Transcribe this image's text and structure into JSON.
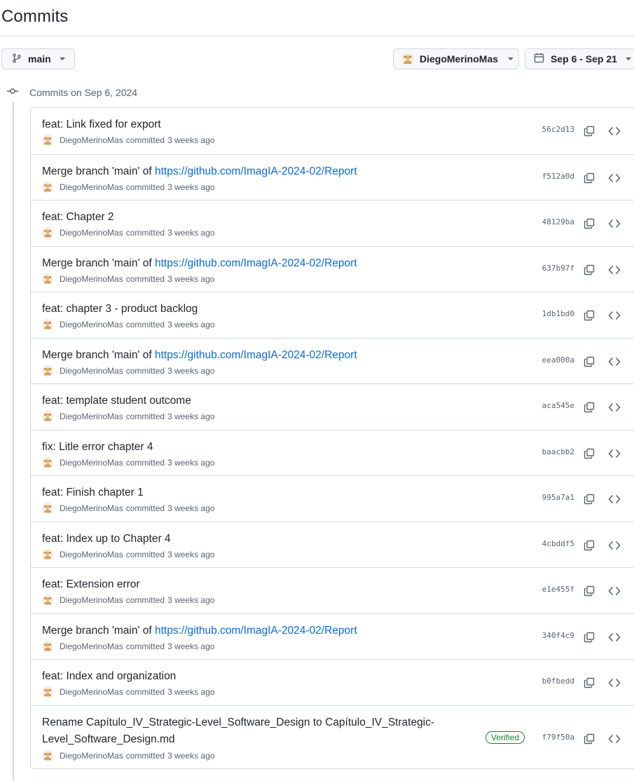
{
  "page": {
    "title": "Commits"
  },
  "toolbar": {
    "branch_label": "main",
    "user_label": "DiegoMerinoMas",
    "date_range_label": "Sep 6 - Sep 21"
  },
  "group": {
    "label": "Commits on Sep 6, 2024"
  },
  "commits": [
    {
      "title": "feat: Link fixed for export",
      "author": "DiegoMerinoMas",
      "action": "committed",
      "time": "3 weeks ago",
      "sha": "56c2d13"
    },
    {
      "title_prefix": "Merge branch 'main' of ",
      "link": "https://github.com/ImagIA-2024-02/Report",
      "author": "DiegoMerinoMas",
      "action": "committed",
      "time": "3 weeks ago",
      "sha": "f512a0d"
    },
    {
      "title": "feat: Chapter 2",
      "author": "DiegoMerinoMas",
      "action": "committed",
      "time": "3 weeks ago",
      "sha": "48129ba"
    },
    {
      "title_prefix": "Merge branch 'main' of ",
      "link": "https://github.com/ImagIA-2024-02/Report",
      "author": "DiegoMerinoMas",
      "action": "committed",
      "time": "3 weeks ago",
      "sha": "637b97f"
    },
    {
      "title": "feat: chapter 3 - product backlog",
      "author": "DiegoMerinoMas",
      "action": "committed",
      "time": "3 weeks ago",
      "sha": "1db1bd0"
    },
    {
      "title_prefix": "Merge branch 'main' of ",
      "link": "https://github.com/ImagIA-2024-02/Report",
      "author": "DiegoMerinoMas",
      "action": "committed",
      "time": "3 weeks ago",
      "sha": "eea000a"
    },
    {
      "title": "feat: template student outcome",
      "author": "DiegoMerinoMas",
      "action": "committed",
      "time": "3 weeks ago",
      "sha": "aca545e"
    },
    {
      "title": "fix: Litle error chapter 4",
      "author": "DiegoMerinoMas",
      "action": "committed",
      "time": "3 weeks ago",
      "sha": "baacbb2"
    },
    {
      "title": "feat: Finish chapter 1",
      "author": "DiegoMerinoMas",
      "action": "committed",
      "time": "3 weeks ago",
      "sha": "995a7a1"
    },
    {
      "title": "feat: Index up to Chapter 4",
      "author": "DiegoMerinoMas",
      "action": "committed",
      "time": "3 weeks ago",
      "sha": "4cbddf5"
    },
    {
      "title": "feat: Extension error",
      "author": "DiegoMerinoMas",
      "action": "committed",
      "time": "3 weeks ago",
      "sha": "e1e455f"
    },
    {
      "title_prefix": "Merge branch 'main' of ",
      "link": "https://github.com/ImagIA-2024-02/Report",
      "author": "DiegoMerinoMas",
      "action": "committed",
      "time": "3 weeks ago",
      "sha": "340f4c9"
    },
    {
      "title": "feat: Index and organization",
      "author": "DiegoMerinoMas",
      "action": "committed",
      "time": "3 weeks ago",
      "sha": "b0fbedd"
    },
    {
      "title": "Rename Capítulo_IV_Strategic-Level_Software_Design to Capítulo_IV_Strategic-Level_Software_Design.md",
      "author": "DiegoMerinoMas",
      "action": "committed",
      "time": "3 weeks ago",
      "sha": "f79f50a",
      "badge": "Verified"
    }
  ],
  "icons": {
    "branch": "git-branch-icon",
    "calendar": "calendar-icon",
    "commit": "git-commit-icon",
    "copy": "copy-icon",
    "browse": "code-brackets-icon",
    "caret": "caret-down-icon"
  },
  "colors": {
    "link": "#0969da",
    "muted": "#59636e",
    "border": "#d1d9e0",
    "verified": "#1a7f37"
  }
}
